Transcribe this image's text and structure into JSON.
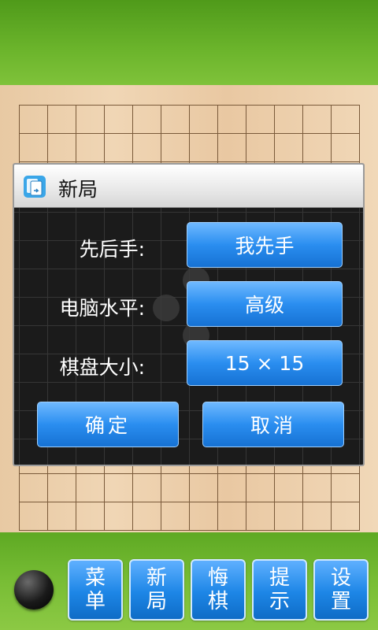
{
  "dialog": {
    "title": "新局",
    "icon": "new-game-icon",
    "rows": [
      {
        "label": "先后手:",
        "value": "我先手"
      },
      {
        "label": "电脑水平:",
        "value": "高级"
      },
      {
        "label": "棋盘大小:",
        "value": "15 × 15"
      }
    ],
    "confirm_label": "确定",
    "cancel_label": "取消"
  },
  "toolbar": {
    "current_stone": "black-stone",
    "buttons": [
      {
        "label": "菜单"
      },
      {
        "label": "新局"
      },
      {
        "label": "悔棋"
      },
      {
        "label": "提示"
      },
      {
        "label": "设置"
      }
    ]
  },
  "colors": {
    "accent_blue": "#2a8ef0",
    "bar_green": "#6cb52c",
    "board_wood": "#f0d6b5"
  }
}
